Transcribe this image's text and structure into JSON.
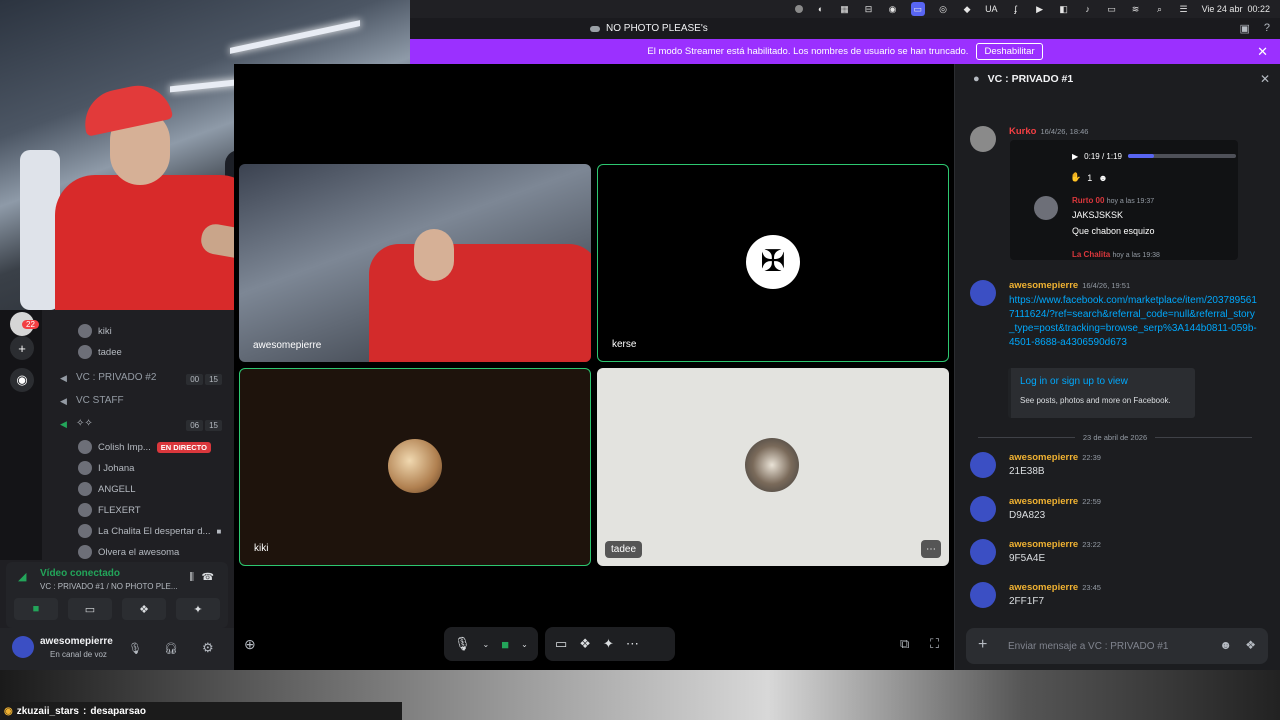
{
  "menubar": {
    "items": [
      "UA"
    ],
    "date": "Vie 24 abr",
    "time": "00:22"
  },
  "window": {
    "title": "NO PHOTO PLEASE's"
  },
  "banner": {
    "text": "El modo Streamer está habilitado. Los nombres de usuario se han truncado.",
    "button": "Deshabilitar"
  },
  "tiles": [
    {
      "label": "awesomepierre"
    },
    {
      "label": "kerse"
    },
    {
      "label": "kiki"
    },
    {
      "label": "tadee"
    }
  ],
  "sidebar": {
    "guild_badge": "22",
    "users_top": [
      "kiki",
      "tadee"
    ],
    "channels": [
      {
        "name": "VC : PRIVADO #2",
        "count_a": "00",
        "count_b": "15"
      },
      {
        "name": "VC STAFF"
      },
      {
        "name": "",
        "count_a": "06",
        "count_b": "15"
      }
    ],
    "users": [
      {
        "name": "Colish Imp...",
        "live": "EN DIRECTO"
      },
      {
        "name": "I Johana"
      },
      {
        "name": "ANGELL"
      },
      {
        "name": "FLEXERT"
      },
      {
        "name": "La Chalita El despertar d..."
      },
      {
        "name": "Olvera el awesoma"
      }
    ],
    "voice": {
      "status": "Vídeo conectado",
      "channel": "VC : PRIVADO #1 / NO PHOTO PLE..."
    },
    "user": {
      "name": "awesomepierre",
      "status": "En canal de voz"
    }
  },
  "chat": {
    "header": "VC : PRIVADO #1",
    "kurko": {
      "name": "Kurko",
      "time": "16/4/26, 18:46"
    },
    "audio": {
      "time": "0:19 / 1:19",
      "progress": 0.24
    },
    "reaction_count": "1",
    "reply": {
      "name": "Rurto 00",
      "time": "hoy a las 19:37",
      "line1": "JAKSJSKSK",
      "line2": "Que chabon esquizo",
      "next_name": "La Chalita",
      "next_time": "hoy a las 19:38"
    },
    "link_msg": {
      "name": "awesomepierre",
      "time": "16/4/26, 19:51",
      "url": "https://www.facebook.com/marketplace/item/2037895617111624/?ref=search&referral_code=null&referral_story_type=post&tracking=browse_serp%3A144b0811-059b-4501-8688-a4306590d673"
    },
    "embed": {
      "title": "Log in or sign up to view",
      "desc": "See posts, photos and more on Facebook."
    },
    "date_divider": "23 de abril de 2026",
    "messages": [
      {
        "name": "awesomepierre",
        "time": "22:39",
        "text": "21E38B"
      },
      {
        "name": "awesomepierre",
        "time": "22:59",
        "text": "D9A823"
      },
      {
        "name": "awesomepierre",
        "time": "23:22",
        "text": "9F5A4E"
      },
      {
        "name": "awesomepierre",
        "time": "23:45",
        "text": "2FF1F7"
      }
    ],
    "input_placeholder": "Enviar mensaje a VC : PRIVADO #1"
  },
  "stream_chat": {
    "user": "zkuzaii_stars",
    "text": "desaparsao"
  },
  "colors": {
    "accent": "#5865f2",
    "streamer_banner": "#9b30ff",
    "hangup": "#da373c",
    "connected": "#23a55a",
    "username": "#f0b232",
    "link": "#00a8fc"
  }
}
